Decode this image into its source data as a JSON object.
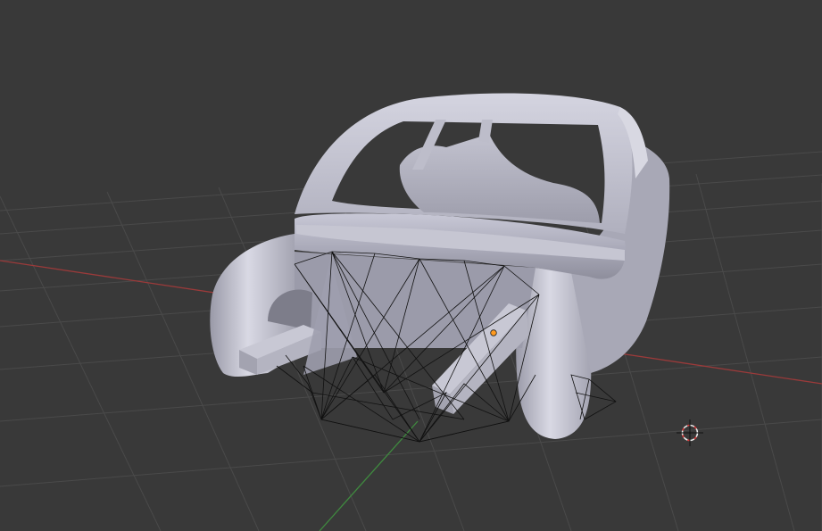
{
  "viewport": {
    "background": "#393939",
    "grid_color": "#4a4a4a",
    "x_axis_color": "#9a3a3a",
    "y_axis_color": "#3f8a3f",
    "wire_color": "#111111",
    "mesh_color": "#b8b8c4",
    "origin_color": "#ff9a1f"
  },
  "objects": {
    "car_body": "car-shell-mesh",
    "wireframe": "selected-wireframe-object",
    "cursor": "3d-cursor-icon"
  }
}
